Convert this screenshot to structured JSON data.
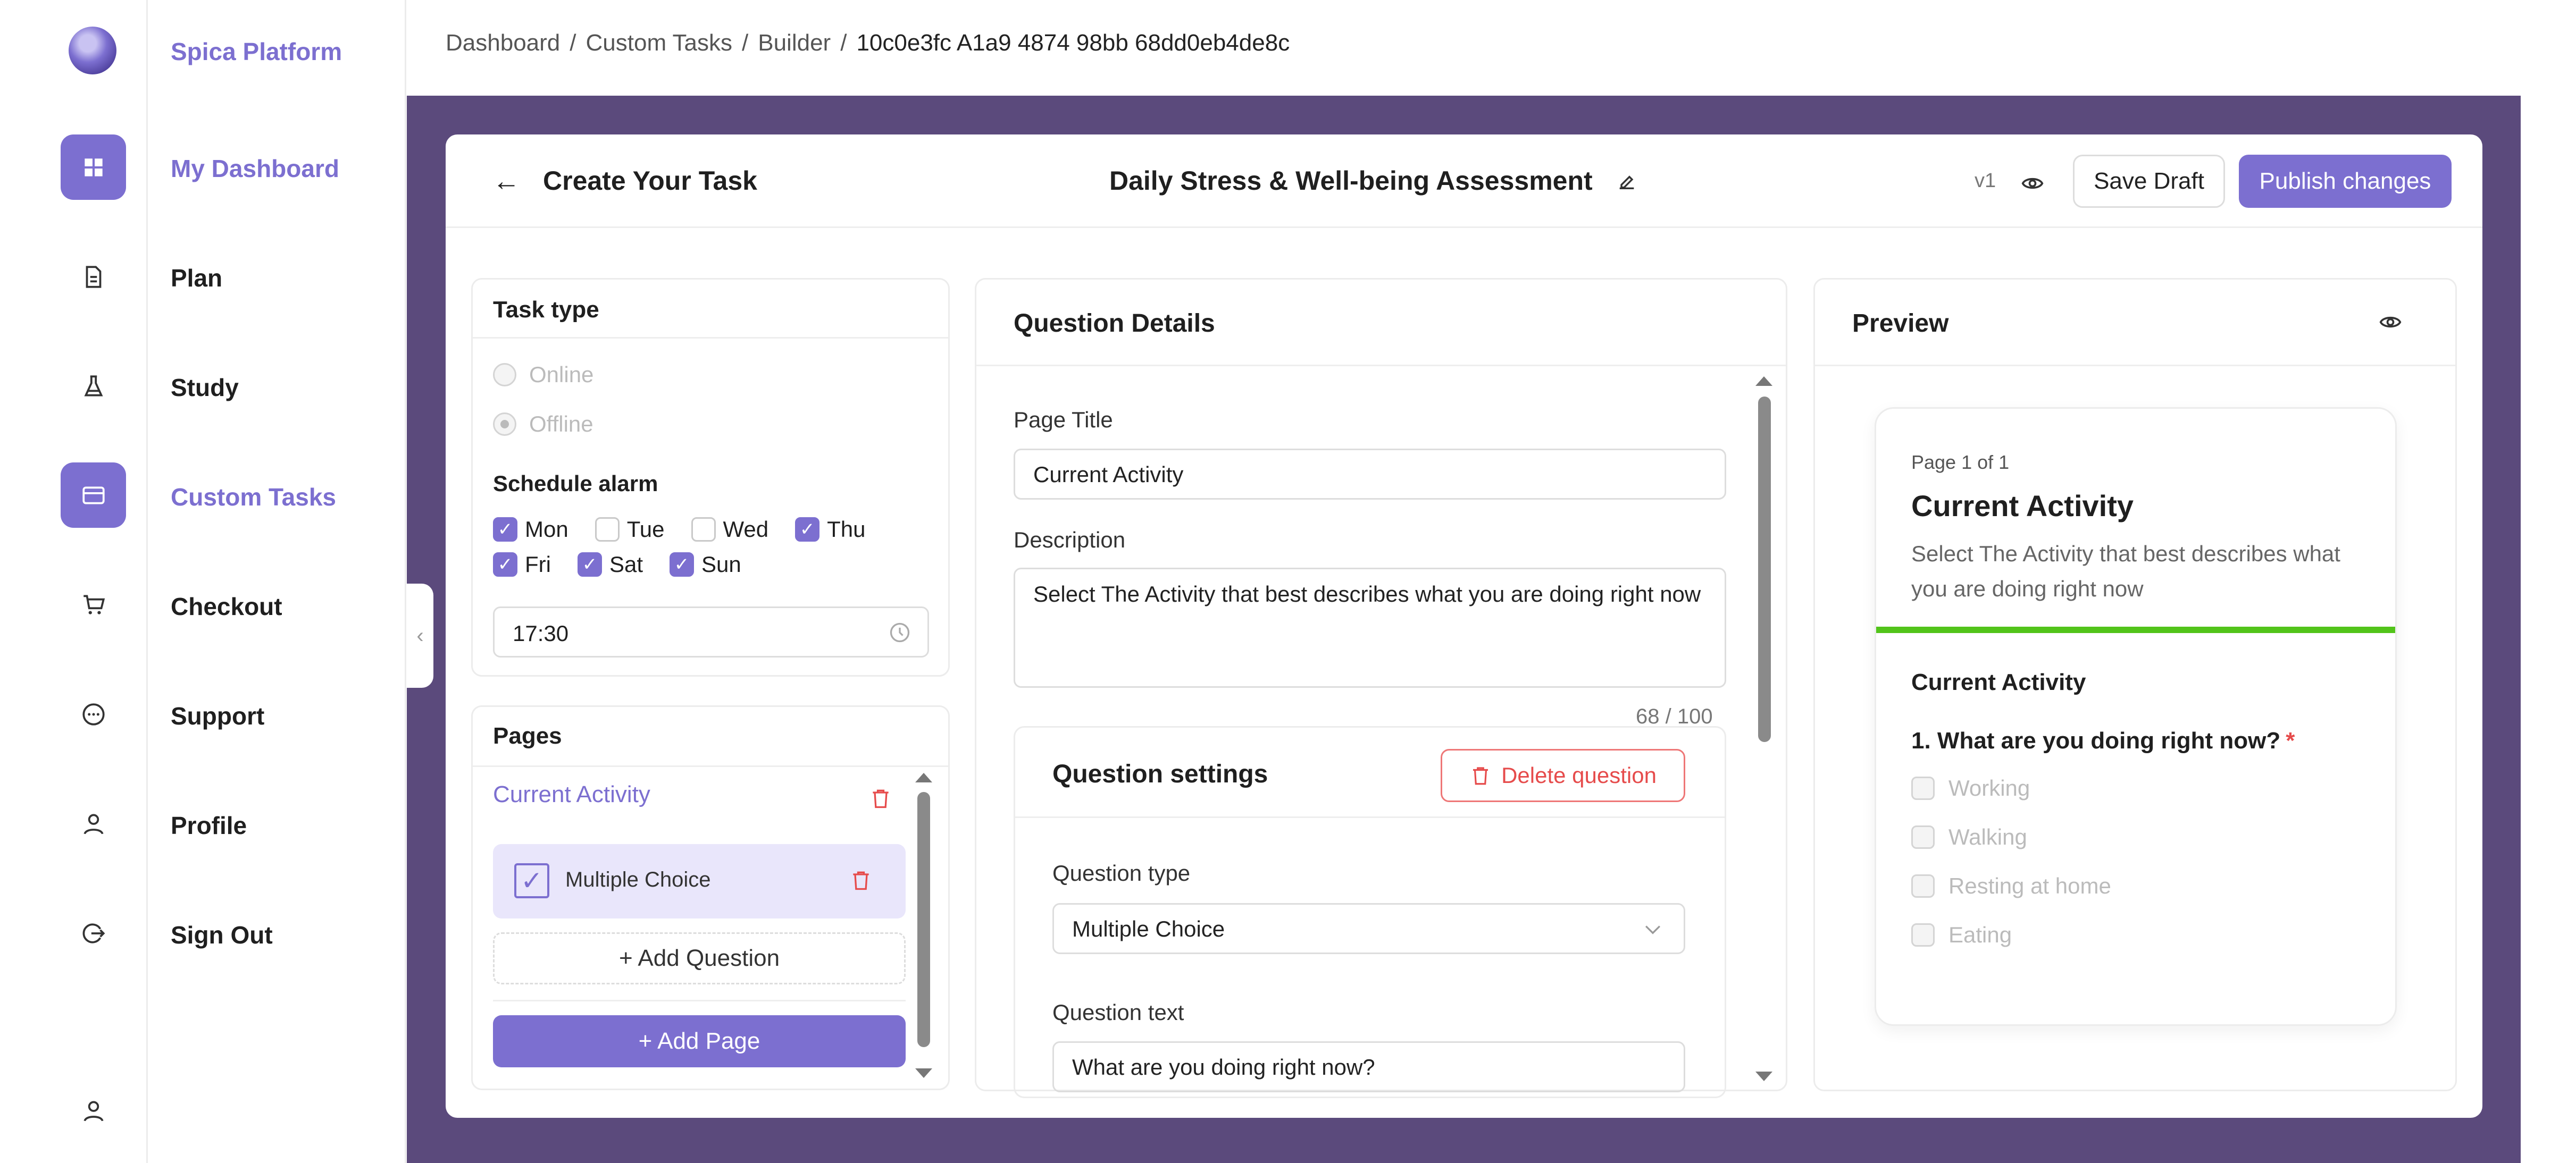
{
  "brand": {
    "name": "Spica Platform"
  },
  "nav": {
    "items": [
      {
        "label": "My Dashboard",
        "icon": "grid-icon"
      },
      {
        "label": "Plan",
        "icon": "document-icon"
      },
      {
        "label": "Study",
        "icon": "flask-icon"
      },
      {
        "label": "Custom Tasks",
        "icon": "card-icon"
      },
      {
        "label": "Checkout",
        "icon": "cart-icon"
      },
      {
        "label": "Support",
        "icon": "chat-icon"
      },
      {
        "label": "Profile",
        "icon": "user-icon"
      },
      {
        "label": "Sign Out",
        "icon": "signout-icon"
      }
    ],
    "bottom_icon": "user-icon"
  },
  "breadcrumb": {
    "items": [
      "Dashboard",
      "Custom Tasks",
      "Builder"
    ],
    "current": "10c0e3fc A1a9 4874 98bb 68dd0eb4de8c",
    "separator": "/"
  },
  "header": {
    "back_label": "←",
    "title": "Create Your Task",
    "task_name": "Daily Stress & Well-being Assessment",
    "version": "v1",
    "save_draft": "Save Draft",
    "publish": "Publish changes"
  },
  "task_type": {
    "title": "Task type",
    "options": [
      "Online",
      "Offline"
    ],
    "selected": "Offline",
    "schedule_title": "Schedule alarm",
    "days": [
      {
        "label": "Mon",
        "checked": true
      },
      {
        "label": "Tue",
        "checked": false
      },
      {
        "label": "Wed",
        "checked": false
      },
      {
        "label": "Thu",
        "checked": true
      },
      {
        "label": "Fri",
        "checked": true
      },
      {
        "label": "Sat",
        "checked": true
      },
      {
        "label": "Sun",
        "checked": true
      }
    ],
    "time": "17:30"
  },
  "pages": {
    "title": "Pages",
    "page_name": "Current Activity",
    "question_label": "Multiple Choice",
    "add_question": "+ Add Question",
    "add_page": "+ Add Page"
  },
  "details": {
    "title": "Question Details",
    "page_title_label": "Page Title",
    "page_title_value": "Current Activity",
    "description_label": "Description",
    "description_value": "Select The Activity that best describes what you are doing right now",
    "counter": "68 / 100",
    "settings_title": "Question settings",
    "delete_label": "Delete question",
    "qtype_label": "Question type",
    "qtype_value": "Multiple Choice",
    "qtext_label": "Question text",
    "qtext_value": "What are you doing right now?"
  },
  "preview": {
    "title": "Preview",
    "page_of": "Page 1 of 1",
    "page_title": "Current Activity",
    "description": "Select The Activity that best describes what you are doing right now",
    "section": "Current Activity",
    "question": "1. What are you doing right now?",
    "required_mark": "*",
    "options": [
      "Working",
      "Walking",
      "Resting at home",
      "Eating"
    ]
  },
  "colors": {
    "accent": "#7c6fd0",
    "stage": "#5b4a7c",
    "danger": "#e64b4b",
    "progress": "#52c41a"
  }
}
